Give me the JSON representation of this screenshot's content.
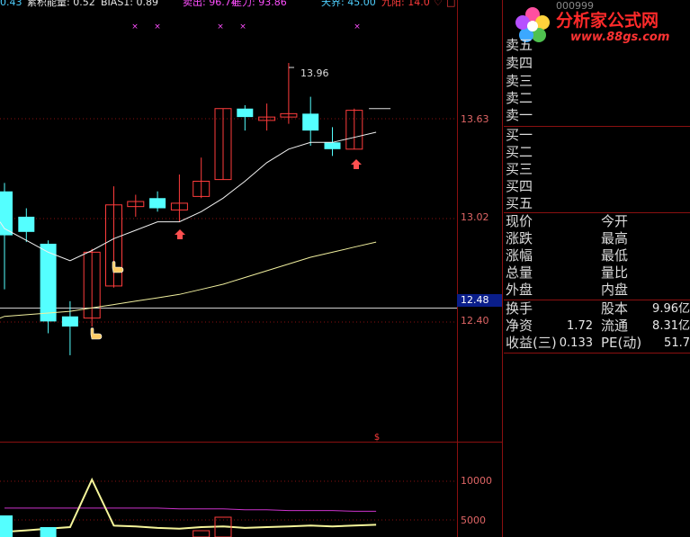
{
  "indicators": {
    "prefix": "0.43",
    "energy_label": "累积能量: 0.52",
    "bias_label": "BIAS1: 0.89",
    "sell_label": "卖出: 96.74",
    "pressure_label": "压力: 93.86",
    "top_label": "天界: 45.00",
    "sky_label": "九阳: 14.0"
  },
  "price_axis": {
    "ticks": [
      "13.63",
      "13.02",
      "12.40"
    ],
    "last_price_badge": "12.48",
    "peak_annotation": "13.96"
  },
  "volume_axis": {
    "ticks": [
      "10000",
      "5000"
    ]
  },
  "chart_data": {
    "type": "candlestick",
    "candles": [
      {
        "o": 13.2,
        "h": 13.25,
        "l": 12.62,
        "c": 12.94
      },
      {
        "o": 13.05,
        "h": 13.1,
        "l": 12.9,
        "c": 12.96
      },
      {
        "o": 12.89,
        "h": 12.91,
        "l": 12.36,
        "c": 12.43
      },
      {
        "o": 12.46,
        "h": 12.55,
        "l": 12.23,
        "c": 12.4
      },
      {
        "o": 12.45,
        "h": 12.86,
        "l": 12.4,
        "c": 12.84
      },
      {
        "o": 12.64,
        "h": 13.23,
        "l": 12.63,
        "c": 13.12
      },
      {
        "o": 13.11,
        "h": 13.18,
        "l": 13.05,
        "c": 13.14
      },
      {
        "o": 13.16,
        "h": 13.2,
        "l": 13.08,
        "c": 13.1
      },
      {
        "o": 13.09,
        "h": 13.3,
        "l": 13.02,
        "c": 13.13
      },
      {
        "o": 13.17,
        "h": 13.4,
        "l": 13.16,
        "c": 13.26
      },
      {
        "o": 13.27,
        "h": 13.69,
        "l": 13.27,
        "c": 13.69
      },
      {
        "o": 13.69,
        "h": 13.71,
        "l": 13.56,
        "c": 13.64
      },
      {
        "o": 13.62,
        "h": 13.72,
        "l": 13.56,
        "c": 13.64
      },
      {
        "o": 13.64,
        "h": 13.96,
        "l": 13.6,
        "c": 13.66
      },
      {
        "o": 13.66,
        "h": 13.76,
        "l": 13.47,
        "c": 13.56
      },
      {
        "o": 13.49,
        "h": 13.58,
        "l": 13.41,
        "c": 13.45
      },
      {
        "o": 13.45,
        "h": 13.69,
        "l": 13.45,
        "c": 13.68
      },
      {
        "o": 13.69,
        "h": 13.69,
        "l": 13.69,
        "c": 13.69
      }
    ],
    "ma_short": [
      12.98,
      12.91,
      12.84,
      12.79,
      12.85,
      12.92,
      12.97,
      13.02,
      13.02,
      13.08,
      13.16,
      13.26,
      13.37,
      13.45,
      13.49,
      13.49,
      13.52,
      13.55
    ],
    "ma_long": [
      12.46,
      12.47,
      12.48,
      12.49,
      12.51,
      12.53,
      12.55,
      12.57,
      12.59,
      12.62,
      12.65,
      12.69,
      12.73,
      12.77,
      12.81,
      12.84,
      12.87,
      12.9
    ],
    "volume_line": [
      3600,
      3800,
      4000,
      4200,
      10200,
      4400,
      4300,
      4100,
      4000,
      4200,
      4300,
      4100,
      4200,
      4300,
      4400,
      4300,
      4400,
      4500
    ],
    "purple_line": [
      6600,
      6600,
      6600,
      6600,
      6600,
      6600,
      6600,
      6600,
      6500,
      6500,
      6500,
      6400,
      6400,
      6300,
      6300,
      6300,
      6200,
      6200
    ],
    "ylim": [
      12.3,
      14.02
    ],
    "vol_ylim": [
      3000,
      12000
    ]
  },
  "colors": {
    "up": "#ff3c3c",
    "down": "#54ffff",
    "grid": "#8a1010",
    "ma_short": "#f2f2f2",
    "ma_long": "#f0ef9e",
    "volume_line": "#f5f59a",
    "purple": "#cc33cc"
  },
  "logo": {
    "code": "000999",
    "title": "分析家公式网",
    "url": "www.88gs.com"
  },
  "quote": {
    "sell5": "卖五",
    "sell4": "卖四",
    "sell3": "卖三",
    "sell2": "卖二",
    "sell1": "卖一",
    "buy1": "买一",
    "buy2": "买二",
    "buy3": "买三",
    "buy4": "买四",
    "buy5": "买五",
    "stats": [
      {
        "left": "现价",
        "right": "今开"
      },
      {
        "left": "涨跌",
        "right": "最高"
      },
      {
        "left": "涨幅",
        "right": "最低"
      },
      {
        "left": "总量",
        "right": "量比"
      },
      {
        "left": "外盘",
        "right": "内盘"
      }
    ],
    "fundamentals": [
      {
        "left": "换手",
        "left_val": "",
        "right": "股本",
        "right_val": "9.96亿"
      },
      {
        "left": "净资",
        "left_val": "1.72",
        "right": "流通",
        "right_val": "8.31亿"
      },
      {
        "left": "收益(三)",
        "left_val": "0.133",
        "right": "PE(动)",
        "right_val": "51.7"
      }
    ]
  }
}
